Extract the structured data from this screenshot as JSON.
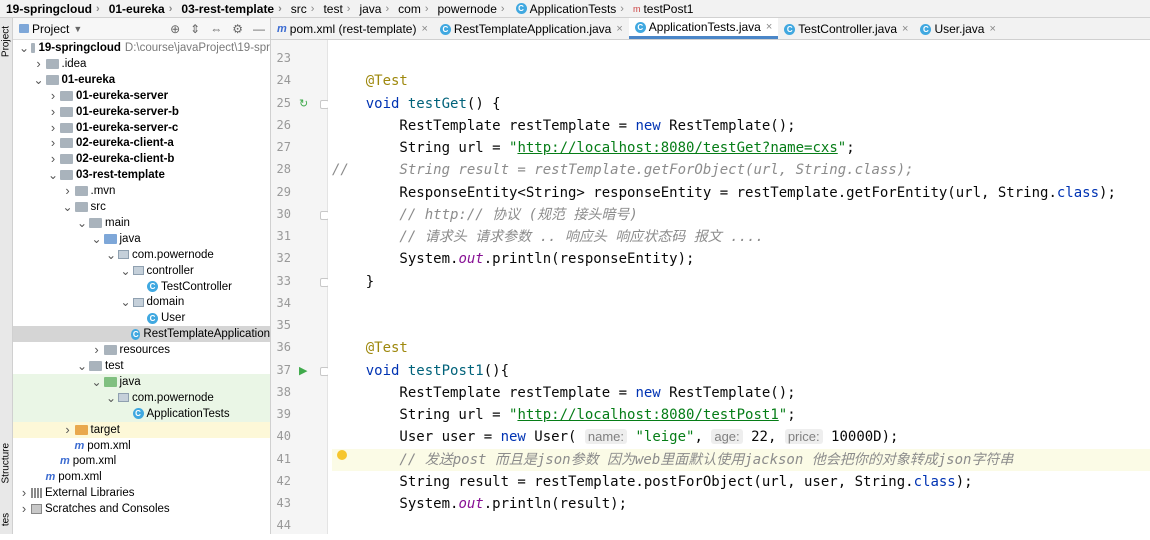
{
  "breadcrumb": {
    "items": [
      {
        "label": "19-springcloud",
        "bold": true,
        "icon": ""
      },
      {
        "label": "01-eureka",
        "bold": true,
        "icon": ""
      },
      {
        "label": "03-rest-template",
        "bold": true,
        "icon": ""
      },
      {
        "label": "src",
        "bold": false,
        "icon": ""
      },
      {
        "label": "test",
        "bold": false,
        "icon": ""
      },
      {
        "label": "java",
        "bold": false,
        "icon": ""
      },
      {
        "label": "com",
        "bold": false,
        "icon": ""
      },
      {
        "label": "powernode",
        "bold": false,
        "icon": ""
      },
      {
        "label": "ApplicationTests",
        "bold": false,
        "icon": "class-icon"
      },
      {
        "label": "testPost1",
        "bold": false,
        "icon": "method-icon"
      }
    ]
  },
  "toolstrip": {
    "project_label": "Project",
    "structure_label": "Structure",
    "favorites_label": "tes"
  },
  "project_panel": {
    "title": "Project",
    "header_icons": [
      "target-icon",
      "expand-icon",
      "collapse-icon",
      "gear-icon",
      "minimize-icon"
    ],
    "tree": [
      {
        "label": "19-springcloud",
        "path": "D:\\course\\javaProject\\19-spr",
        "depth": 0,
        "arrow": "down",
        "icon": "folder-gray",
        "bold": true
      },
      {
        "label": ".idea",
        "depth": 1,
        "arrow": "right",
        "icon": "folder-gray"
      },
      {
        "label": "01-eureka",
        "depth": 1,
        "arrow": "down",
        "icon": "folder-gray",
        "bold": true
      },
      {
        "label": "01-eureka-server",
        "depth": 2,
        "arrow": "right",
        "icon": "folder-gray",
        "bold": true
      },
      {
        "label": "01-eureka-server-b",
        "depth": 2,
        "arrow": "right",
        "icon": "folder-gray",
        "bold": true
      },
      {
        "label": "01-eureka-server-c",
        "depth": 2,
        "arrow": "right",
        "icon": "folder-gray",
        "bold": true
      },
      {
        "label": "02-eureka-client-a",
        "depth": 2,
        "arrow": "right",
        "icon": "folder-gray",
        "bold": true
      },
      {
        "label": "02-eureka-client-b",
        "depth": 2,
        "arrow": "right",
        "icon": "folder-gray",
        "bold": true
      },
      {
        "label": "03-rest-template",
        "depth": 2,
        "arrow": "down",
        "icon": "folder-gray",
        "bold": true
      },
      {
        "label": ".mvn",
        "depth": 3,
        "arrow": "right",
        "icon": "folder-gray"
      },
      {
        "label": "src",
        "depth": 3,
        "arrow": "down",
        "icon": "folder-gray"
      },
      {
        "label": "main",
        "depth": 4,
        "arrow": "down",
        "icon": "folder-gray"
      },
      {
        "label": "java",
        "depth": 5,
        "arrow": "down",
        "icon": "folder-blue"
      },
      {
        "label": "com.powernode",
        "depth": 6,
        "arrow": "down",
        "icon": "package"
      },
      {
        "label": "controller",
        "depth": 7,
        "arrow": "down",
        "icon": "package"
      },
      {
        "label": "TestController",
        "depth": 8,
        "arrow": "",
        "icon": "class"
      },
      {
        "label": "domain",
        "depth": 7,
        "arrow": "down",
        "icon": "package"
      },
      {
        "label": "User",
        "depth": 8,
        "arrow": "",
        "icon": "class"
      },
      {
        "label": "RestTemplateApplication",
        "depth": 7,
        "arrow": "",
        "icon": "class",
        "selected": true
      },
      {
        "label": "resources",
        "depth": 5,
        "arrow": "right",
        "icon": "folder-gray"
      },
      {
        "label": "test",
        "depth": 4,
        "arrow": "down",
        "icon": "folder-gray"
      },
      {
        "label": "java",
        "depth": 5,
        "arrow": "down",
        "icon": "folder-green",
        "green": true
      },
      {
        "label": "com.powernode",
        "depth": 6,
        "arrow": "down",
        "icon": "package",
        "green": true
      },
      {
        "label": "ApplicationTests",
        "depth": 7,
        "arrow": "",
        "icon": "class",
        "green": true
      },
      {
        "label": "target",
        "depth": 3,
        "arrow": "right",
        "icon": "folder-orange",
        "yellow": true
      },
      {
        "label": "pom.xml",
        "depth": 3,
        "arrow": "",
        "icon": "maven"
      },
      {
        "label": "pom.xml",
        "depth": 2,
        "arrow": "",
        "icon": "maven"
      },
      {
        "label": "pom.xml",
        "depth": 1,
        "arrow": "",
        "icon": "maven"
      },
      {
        "label": "External Libraries",
        "depth": 0,
        "arrow": "right",
        "icon": "library"
      },
      {
        "label": "Scratches and Consoles",
        "depth": 0,
        "arrow": "right",
        "icon": "scratch"
      }
    ]
  },
  "tabs": [
    {
      "label": "pom.xml (rest-template)",
      "icon": "maven",
      "active": false
    },
    {
      "label": "RestTemplateApplication.java",
      "icon": "class",
      "active": false
    },
    {
      "label": "ApplicationTests.java",
      "icon": "class",
      "active": true
    },
    {
      "label": "TestController.java",
      "icon": "class",
      "active": false
    },
    {
      "label": "User.java",
      "icon": "class",
      "active": false
    }
  ],
  "editor": {
    "lines": [
      {
        "num": "23",
        "tokens": []
      },
      {
        "num": "24",
        "tokens": [
          [
            "    ",
            ""
          ],
          [
            "@Test",
            "an"
          ]
        ]
      },
      {
        "num": "25",
        "gutter": "run-check",
        "fold": true,
        "tokens": [
          [
            "    ",
            ""
          ],
          [
            "void",
            "kw"
          ],
          [
            " ",
            ""
          ],
          [
            "testGet",
            "mth"
          ],
          [
            "() {",
            ""
          ]
        ]
      },
      {
        "num": "26",
        "tokens": [
          [
            "        RestTemplate restTemplate = ",
            ""
          ],
          [
            "new",
            "kw"
          ],
          [
            " RestTemplate();",
            ""
          ]
        ]
      },
      {
        "num": "27",
        "tokens": [
          [
            "        String url = ",
            ""
          ],
          [
            "\"",
            "str"
          ],
          [
            "http://localhost:8080/testGet?name=cxs",
            "url"
          ],
          [
            "\"",
            "str"
          ],
          [
            ";",
            ""
          ]
        ]
      },
      {
        "num": "28",
        "tokens": [
          [
            "//",
            "cm"
          ],
          [
            "      String result = restTemplate.getForObject(url, String.class);",
            "cm"
          ]
        ]
      },
      {
        "num": "29",
        "tokens": [
          [
            "        ResponseEntity<String> responseEntity = restTemplate.getForEntity(url, String.",
            ""
          ],
          [
            "class",
            "kw"
          ],
          [
            ");",
            ""
          ]
        ]
      },
      {
        "num": "30",
        "fold": true,
        "tokens": [
          [
            "        // http:// 协议 (规范 接头暗号)",
            "cm"
          ]
        ]
      },
      {
        "num": "31",
        "tokens": [
          [
            "        // 请求头 请求参数 .. 响应头 响应状态码 报文 ....",
            "cm"
          ]
        ]
      },
      {
        "num": "32",
        "tokens": [
          [
            "        System.",
            ""
          ],
          [
            "out",
            "fld"
          ],
          [
            ".println(responseEntity);",
            ""
          ]
        ]
      },
      {
        "num": "33",
        "fold": true,
        "tokens": [
          [
            "    }",
            ""
          ]
        ]
      },
      {
        "num": "34",
        "tokens": []
      },
      {
        "num": "35",
        "tokens": []
      },
      {
        "num": "36",
        "tokens": [
          [
            "    ",
            ""
          ],
          [
            "@Test",
            "an"
          ]
        ]
      },
      {
        "num": "37",
        "gutter": "run",
        "fold": true,
        "tokens": [
          [
            "    ",
            ""
          ],
          [
            "void",
            "kw"
          ],
          [
            " ",
            ""
          ],
          [
            "testPost1",
            "mth"
          ],
          [
            "(){",
            ""
          ]
        ]
      },
      {
        "num": "38",
        "tokens": [
          [
            "        RestTemplate restTemplate = ",
            ""
          ],
          [
            "new",
            "kw"
          ],
          [
            " RestTemplate();",
            ""
          ]
        ]
      },
      {
        "num": "39",
        "tokens": [
          [
            "        String url = ",
            ""
          ],
          [
            "\"",
            "str"
          ],
          [
            "http://localhost:8080/testPost1",
            "url"
          ],
          [
            "\"",
            "str"
          ],
          [
            ";",
            ""
          ]
        ]
      },
      {
        "num": "40",
        "tokens": [
          [
            "        User user = ",
            ""
          ],
          [
            "new",
            "kw"
          ],
          [
            " User( ",
            ""
          ],
          [
            "name:",
            "hint"
          ],
          [
            " ",
            ""
          ],
          [
            "\"leige\"",
            "str"
          ],
          [
            ", ",
            ""
          ],
          [
            "age:",
            "hint"
          ],
          [
            " 22, ",
            ""
          ],
          [
            "price:",
            "hint"
          ],
          [
            " 10000D);",
            ""
          ]
        ]
      },
      {
        "num": "41",
        "highlight": true,
        "bulb": true,
        "tokens": [
          [
            "        // 发送post 而且是json参数 因为web里面默认使用jackson 他会把你的对象转成json字符串",
            "cm"
          ]
        ]
      },
      {
        "num": "42",
        "tokens": [
          [
            "        String result = restTemplate.postForObject(url, user, String.",
            ""
          ],
          [
            "class",
            "kw"
          ],
          [
            ");",
            ""
          ]
        ]
      },
      {
        "num": "43",
        "tokens": [
          [
            "        System.",
            ""
          ],
          [
            "out",
            "fld"
          ],
          [
            ".println(result);",
            ""
          ]
        ]
      },
      {
        "num": "44",
        "tokens": []
      }
    ]
  },
  "colors": {
    "accent": "#4a86c8",
    "selection": "#d5d5d5",
    "test_bg": "#eaf6e6",
    "excluded_bg": "#fdf8d8",
    "run_green": "#3faa4b"
  }
}
